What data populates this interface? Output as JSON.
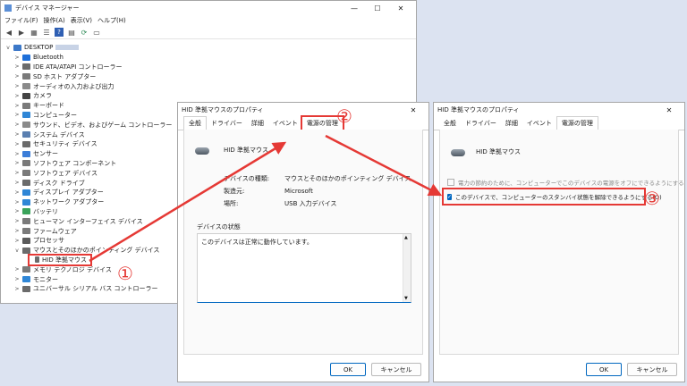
{
  "devmgr": {
    "title": "デバイス マネージャー",
    "menu": [
      "ファイル(F)",
      "操作(A)",
      "表示(V)",
      "ヘルプ(H)"
    ],
    "root": "DESKTOP",
    "items": [
      "Bluetooth",
      "IDE ATA/ATAPI コントローラー",
      "SD ホスト アダプター",
      "オーディオの入力および出力",
      "カメラ",
      "キーボード",
      "コンピューター",
      "サウンド、ビデオ、およびゲーム コントローラー",
      "システム デバイス",
      "セキュリティ デバイス",
      "センサー",
      "ソフトウェア コンポーネント",
      "ソフトウェア デバイス",
      "ディスク ドライブ",
      "ディスプレイ アダプター",
      "ネットワーク アダプター",
      "バッテリ",
      "ヒューマン インターフェイス デバイス",
      "ファームウェア",
      "プロセッサ",
      "マウスとそのほかのポインティング デバイス"
    ],
    "selected": "HID 準拠マウス",
    "after": [
      "メモリ テクノロジ デバイス",
      "モニター",
      "ユニバーサル シリアル バス コントローラー"
    ]
  },
  "dialog1": {
    "title": "HID 準拠マウスのプロパティ",
    "tabs": [
      "全般",
      "ドライバー",
      "詳細",
      "イベント",
      "電源の管理"
    ],
    "device_name": "HID 準拠マウス",
    "props": [
      {
        "label": "デバイスの種類:",
        "value": "マウスとそのほかのポインティング デバイス"
      },
      {
        "label": "製造元:",
        "value": "Microsoft"
      },
      {
        "label": "場所:",
        "value": "USB 入力デバイス"
      }
    ],
    "status_label": "デバイスの状態",
    "status_text": "このデバイスは正常に動作しています。",
    "ok": "OK",
    "cancel": "キャンセル"
  },
  "dialog2": {
    "title": "HID 準拠マウスのプロパティ",
    "tabs": [
      "全般",
      "ドライバー",
      "詳細",
      "イベント",
      "電源の管理"
    ],
    "device_name": "HID 準拠マウス",
    "opt1": "電力の節約のために、コンピューターでこのデバイスの電源をオフにできるようにする(A)",
    "opt2": "このデバイスで、コンピューターのスタンバイ状態を解除できるようにする(O)",
    "ok": "OK",
    "cancel": "キャンセル"
  },
  "annotations": {
    "n1": "①",
    "n2": "②",
    "n3": "③"
  },
  "colors": {
    "accent": "#e53935",
    "checkbox": "#0067c0"
  }
}
